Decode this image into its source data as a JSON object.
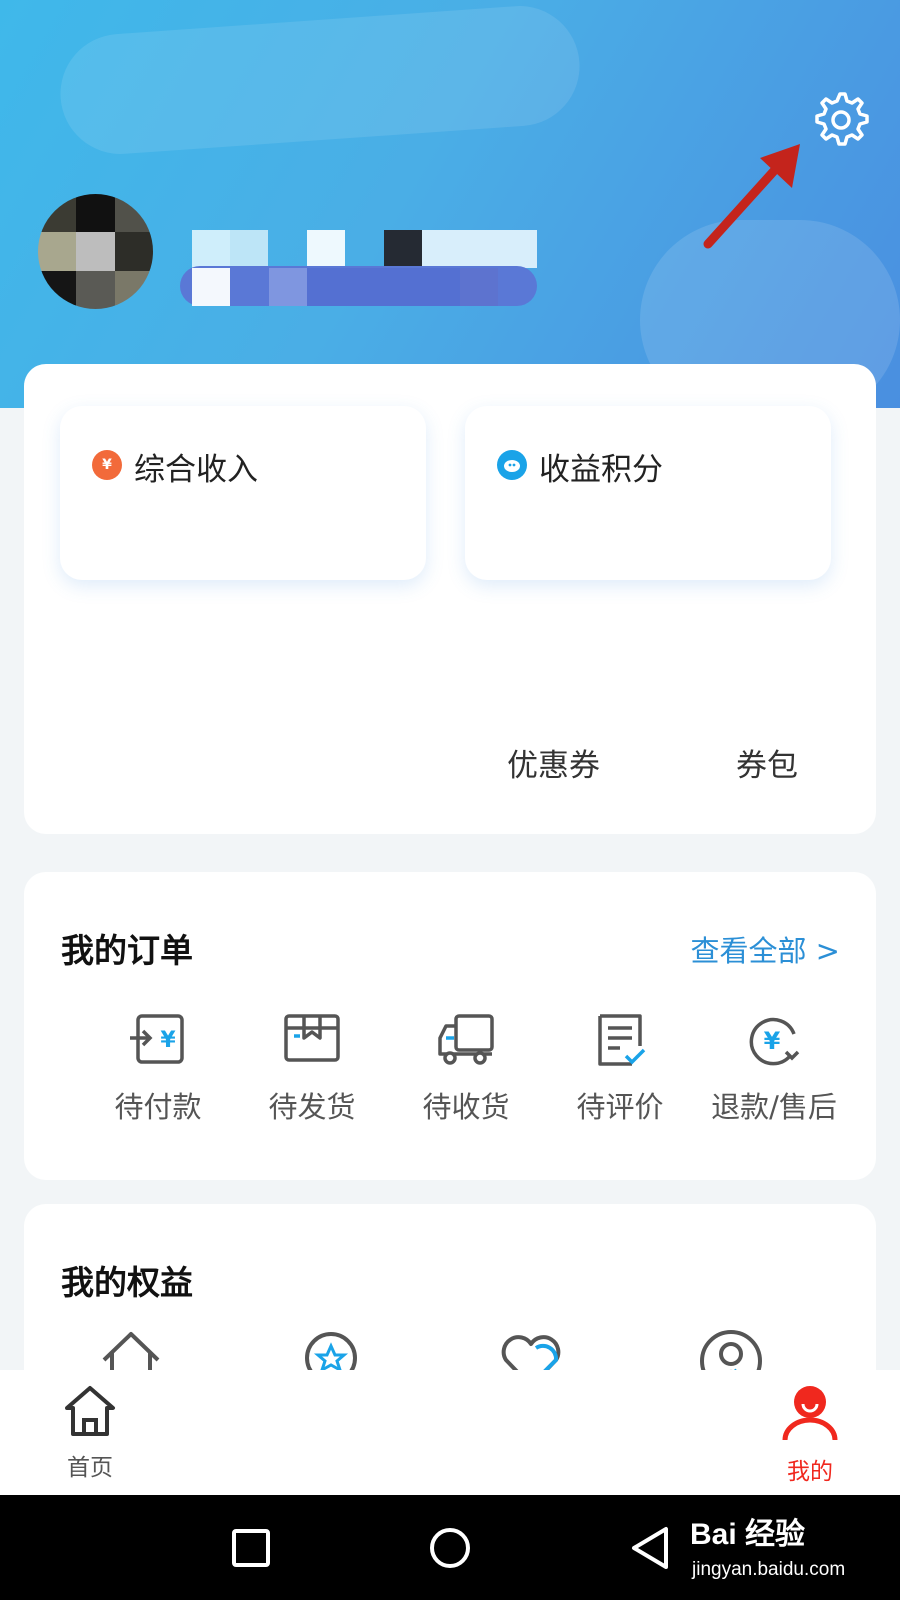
{
  "header": {
    "settings_icon": "gear-icon",
    "annotation_arrow_color": "#c4241c",
    "background_colors": [
      "#3fb8ea",
      "#4a8fe0"
    ]
  },
  "assets": {
    "income_label": "综合收入",
    "income_icon": "money-bag-icon",
    "income_icon_glyph": "¥",
    "points_label": "收益积分",
    "points_icon": "piggy-bank-icon",
    "coupon_label": "优惠券",
    "wallet_label": "券包"
  },
  "orders": {
    "title": "我的订单",
    "view_all": "查看全部 >",
    "items": [
      {
        "label": "待付款",
        "icon": "pending-payment-icon"
      },
      {
        "label": "待发货",
        "icon": "pending-shipment-icon"
      },
      {
        "label": "待收货",
        "icon": "delivery-truck-icon"
      },
      {
        "label": "待评价",
        "icon": "review-icon"
      },
      {
        "label": "退款/售后",
        "icon": "refund-icon"
      }
    ]
  },
  "benefits": {
    "title": "我的权益",
    "icons": [
      "home-icon",
      "star-badge-icon",
      "heart-icon",
      "user-circle-icon"
    ]
  },
  "tabbar": {
    "home_label": "首页",
    "mine_label": "我的",
    "active_color": "#f0281e"
  },
  "system_nav": {
    "watermark_main": "Bai 经验",
    "watermark_sub": "jingyan.baidu.com"
  },
  "colors": {
    "accent_blue": "#2b8fd6",
    "icon_blue": "#1aa3e8",
    "icon_gray": "#555555"
  }
}
